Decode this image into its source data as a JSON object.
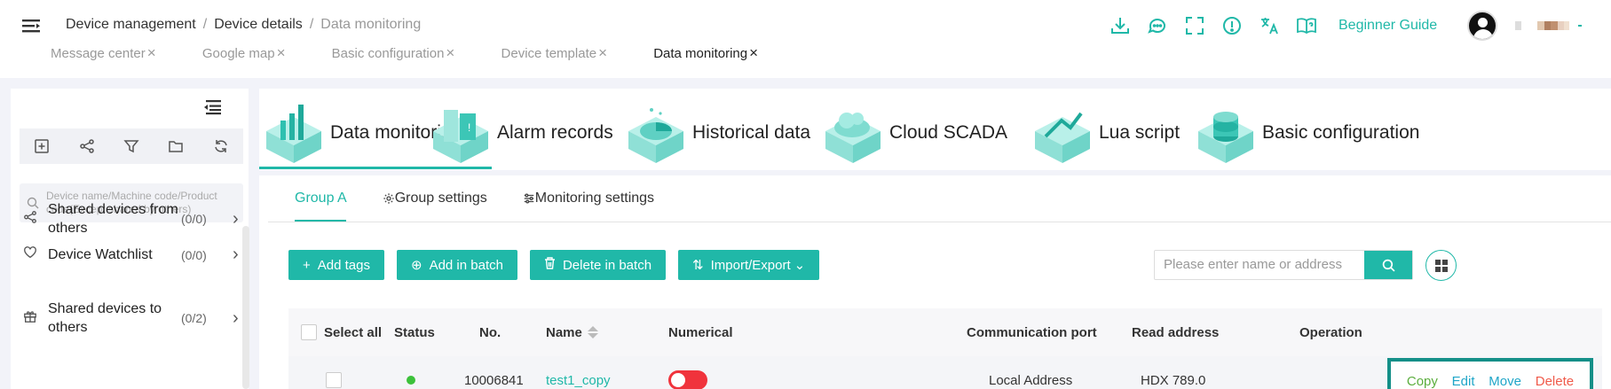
{
  "header": {
    "breadcrumb": [
      "Device management",
      "Device details",
      "Data monitoring"
    ],
    "breadcrumb_sep": "/",
    "tabs": [
      {
        "label": "Message center",
        "close": "×"
      },
      {
        "label": "Google map",
        "close": "×"
      },
      {
        "label": "Basic configuration",
        "close": "×"
      },
      {
        "label": "Device template",
        "close": "×"
      },
      {
        "label": "Data monitoring",
        "close": "×",
        "active": true
      }
    ],
    "tools": [
      "download-icon",
      "message-icon",
      "fullscreen-icon",
      "info-icon",
      "translate-icon",
      "guide-book-icon"
    ],
    "guide_label": "Beginner Guide",
    "accent": "#20b8a8"
  },
  "sidebar": {
    "toolbar_icons": [
      "add-icon",
      "share-icon",
      "filter-icon",
      "folder-icon",
      "refresh-icon"
    ],
    "search_placeholder": "Device name/Machine code/Product code(Except shared by others)",
    "items": [
      {
        "label": "Shared devices from others",
        "count": "(0/0)",
        "icon": "share-icon"
      },
      {
        "label": "Device Watchlist",
        "count": "(0/0)",
        "icon": "heart-icon"
      },
      {
        "label": "Shared devices to others",
        "count": "(0/2)",
        "icon": "gift-icon"
      }
    ]
  },
  "function_tabs": [
    {
      "label": "Data monitoring",
      "icon": "bar-chart-icon",
      "active": true
    },
    {
      "label": "Alarm records",
      "icon": "alarm-icon"
    },
    {
      "label": "Historical data",
      "icon": "pie-chart-icon"
    },
    {
      "label": "Cloud SCADA",
      "icon": "cloud-icon"
    },
    {
      "label": "Lua script",
      "icon": "script-icon"
    },
    {
      "label": "Basic configuration",
      "icon": "database-icon"
    }
  ],
  "subtabs": [
    {
      "label": "Group A",
      "active": true
    },
    {
      "label": "Group settings",
      "icon": "gear-icon"
    },
    {
      "label": "Monitoring settings",
      "icon": "sliders-icon"
    }
  ],
  "actions": {
    "add_tags": "Add tags",
    "add_batch": "Add in batch",
    "delete_batch": "Delete in batch",
    "import_export": "Import/Export"
  },
  "search": {
    "placeholder": "Please enter name or address"
  },
  "table": {
    "columns": {
      "select_all": "Select all",
      "status": "Status",
      "no": "No.",
      "name": "Name",
      "numerical": "Numerical",
      "port": "Communication port",
      "address": "Read address",
      "operation": "Operation"
    },
    "rows": [
      {
        "status": "online",
        "no": "10006841",
        "name": "test1_copy",
        "numerical": "off",
        "port": "Local Address",
        "address": "HDX 789.0",
        "ops": {
          "copy": "Copy",
          "edit": "Edit",
          "move": "Move",
          "delete": "Delete"
        }
      }
    ]
  }
}
